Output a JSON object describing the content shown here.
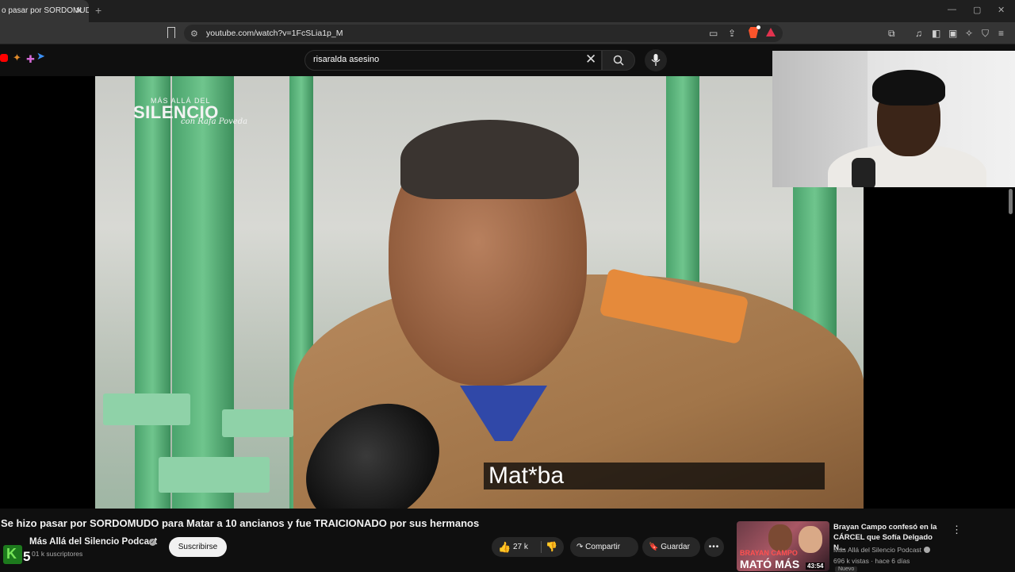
{
  "browser": {
    "tab_title": "o pasar por SORDOMUDO",
    "tab_close": "✕",
    "new_tab": "+",
    "url": "youtube.com/watch?v=1FcSLia1p_M",
    "window_controls": [
      "—",
      "▢",
      "✕"
    ]
  },
  "youtube_header": {
    "search_query": "risaralda asesino",
    "search_clear": "✕",
    "search_icon": "search-icon",
    "mic_icon": "mic-icon"
  },
  "video": {
    "logo_top": "MÁS ALLÁ DEL",
    "logo_main": "SILENCIO",
    "logo_sub": "con Rafa Poveda",
    "caption": "Mat*ba"
  },
  "details": {
    "title": "Se hizo pasar por SORDOMUDO para Matar a 10 ancianos y fue TRAICIONADO por sus hermanos",
    "channel_name": "Más Allá del Silencio Podcast",
    "verified": "✓",
    "subscribers": "01 k suscriptores",
    "avatar_letter": "K",
    "avatar_number": "5",
    "subscribe_label": "Suscribirse",
    "like_icon": "👍",
    "like_count": "27 k",
    "dislike_icon": "👎",
    "share_label": "↷ Compartir",
    "save_label": "🔖 Guardar",
    "more_label": "•••"
  },
  "recommendation": {
    "title": "Brayan Campo confesó en la CÁRCEL que Sofía Delgado N...",
    "channel": "Más Allá del Silencio Podcast",
    "meta": "696 k vistas · hace 6 días",
    "duration": "43:54",
    "badge": "Nuevo",
    "thumb_text_top": "BRAYAN CAMPO",
    "thumb_text_main": "MATÓ MÁS",
    "more": "⋮"
  },
  "colors": {
    "page_bg": "#0f0f0f",
    "accent_red": "#ff0000",
    "brave_orange": "#fb542b"
  }
}
